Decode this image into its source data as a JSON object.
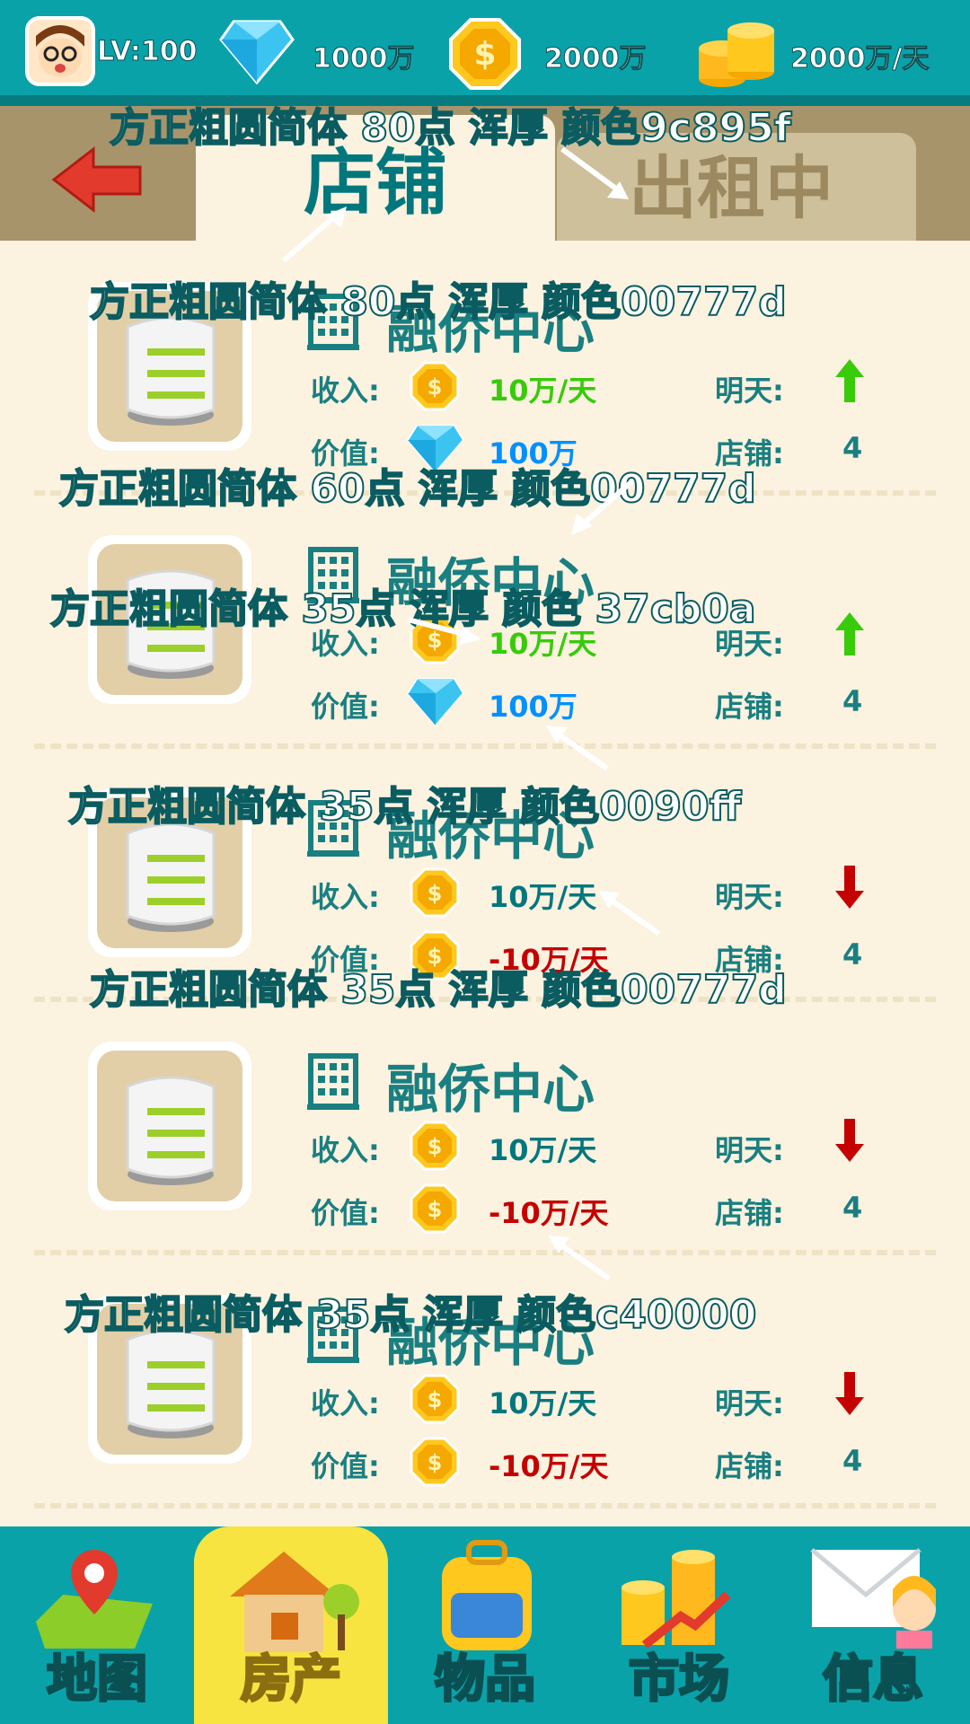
{
  "header": {
    "level": "LV:100",
    "diamonds": "1000万",
    "coins": "2000万",
    "income_rate": "2000万/天"
  },
  "tabs": {
    "active": "店铺",
    "inactive": "出租中"
  },
  "properties": [
    {
      "name": "融侨中心",
      "income_label": "收入:",
      "income": "10万/天",
      "income_color": "#37cb0a",
      "tomorrow_label": "明天:",
      "trend": "up",
      "value_label": "价值:",
      "value": "100万",
      "value_icon": "diamond-icon",
      "value_color": "#0090ff",
      "shops_label": "店铺:",
      "shops": "4"
    },
    {
      "name": "融侨中心",
      "income_label": "收入:",
      "income": "10万/天",
      "income_color": "#37cb0a",
      "tomorrow_label": "明天:",
      "trend": "up",
      "value_label": "价值:",
      "value": "100万",
      "value_icon": "diamond-icon",
      "value_color": "#0090ff",
      "shops_label": "店铺:",
      "shops": "4"
    },
    {
      "name": "融侨中心",
      "income_label": "收入:",
      "income": "10万/天",
      "income_color": "#00777d",
      "tomorrow_label": "明天:",
      "trend": "down",
      "value_label": "价值:",
      "value": "-10万/天",
      "value_icon": "coin-icon",
      "value_color": "#c40000",
      "shops_label": "店铺:",
      "shops": "4"
    },
    {
      "name": "融侨中心",
      "income_label": "收入:",
      "income": "10万/天",
      "income_color": "#00777d",
      "tomorrow_label": "明天:",
      "trend": "down",
      "value_label": "价值:",
      "value": "-10万/天",
      "value_icon": "coin-icon",
      "value_color": "#c40000",
      "shops_label": "店铺:",
      "shops": "4"
    },
    {
      "name": "融侨中心",
      "income_label": "收入:",
      "income": "10万/天",
      "income_color": "#00777d",
      "tomorrow_label": "明天:",
      "trend": "down",
      "value_label": "价值:",
      "value": "-10万/天",
      "value_icon": "coin-icon",
      "value_color": "#c40000",
      "shops_label": "店铺:",
      "shops": "4"
    }
  ],
  "nav": [
    {
      "label": "地图",
      "icon": "map-icon"
    },
    {
      "label": "房产",
      "icon": "house-icon",
      "active": true
    },
    {
      "label": "物品",
      "icon": "backpack-icon"
    },
    {
      "label": "市场",
      "icon": "market-icon"
    },
    {
      "label": "信息",
      "icon": "mail-icon"
    }
  ],
  "annotations": [
    "方正粗圆简体 80点    浑厚    颜色9c895f",
    "方正粗圆简体 80点    浑厚    颜色00777d",
    "方正粗圆简体 60点    浑厚    颜色00777d",
    "方正粗圆简体 35点    浑厚    颜色 37cb0a",
    "方正粗圆简体 35点    浑厚    颜色0090ff",
    "方正粗圆简体 35点    浑厚    颜色00777d",
    "方正粗圆简体 35点    浑厚    颜色c40000"
  ],
  "colors": {
    "teal": "#0aa2a9",
    "title_teal": "#00777d",
    "inactive_tab_text": "#9c895f",
    "income_green": "#37cb0a",
    "value_blue": "#0090ff",
    "loss_red": "#c40000",
    "bg": "#fbf2e0"
  }
}
